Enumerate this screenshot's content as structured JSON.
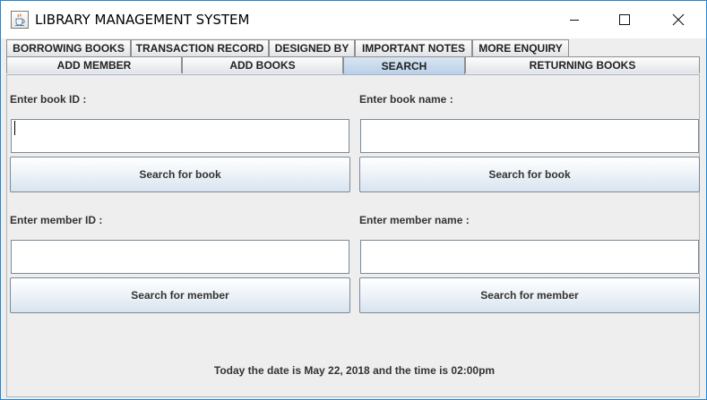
{
  "window": {
    "title": "LIBRARY MANAGEMENT SYSTEM"
  },
  "tabs": {
    "row1": [
      {
        "label": "BORROWING BOOKS"
      },
      {
        "label": "TRANSACTION RECORD"
      },
      {
        "label": "DESIGNED BY"
      },
      {
        "label": "IMPORTANT NOTES"
      },
      {
        "label": "MORE ENQUIRY"
      }
    ],
    "row2": [
      {
        "label": "ADD MEMBER"
      },
      {
        "label": "ADD BOOKS"
      },
      {
        "label": "SEARCH",
        "selected": true
      },
      {
        "label": "RETURNING BOOKS"
      }
    ]
  },
  "search": {
    "book_id_label": "Enter book ID :",
    "book_id_value": "",
    "book_name_label": "Enter book name :",
    "book_name_value": "",
    "search_book_button": "Search for book",
    "member_id_label": "Enter member ID :",
    "member_id_value": "",
    "member_name_label": "Enter member name :",
    "member_name_value": "",
    "search_member_button": "Search for member"
  },
  "status": {
    "text": "Today the date is May 22, 2018 and the time is 02:00pm"
  },
  "colors": {
    "selected_tab": "#b9cfe8",
    "window_border": "#1f87d8",
    "panel_background": "#eeeeee"
  }
}
